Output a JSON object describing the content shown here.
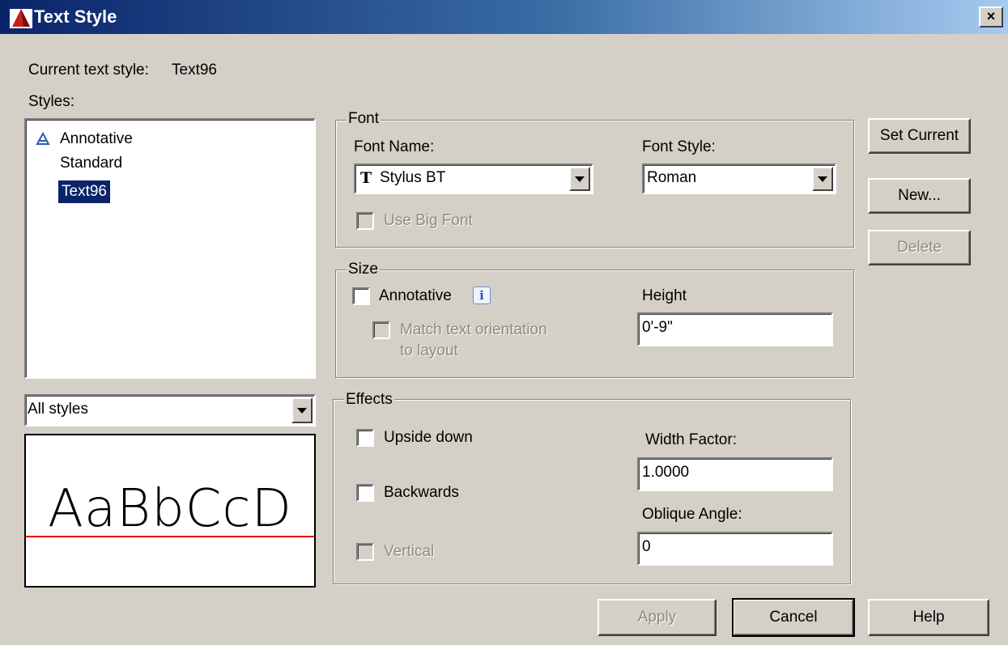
{
  "window": {
    "title": "Text Style",
    "close_glyph": "×"
  },
  "current_style": {
    "label": "Current text style:",
    "value": "Text96"
  },
  "styles": {
    "label": "Styles:",
    "items": [
      {
        "label": "Annotative",
        "icon": "annotative-icon",
        "selected": false
      },
      {
        "label": "Standard",
        "selected": false
      },
      {
        "label": "Text96",
        "selected": true
      }
    ],
    "filter_value": "All styles"
  },
  "preview": {
    "sample_text": "AaBbCcD",
    "baseline_color": "#e00000"
  },
  "font": {
    "group_label": "Font",
    "name_label": "Font Name:",
    "name_value": "Stylus BT",
    "name_icon": "truetype-font-icon",
    "style_label": "Font Style:",
    "style_value": "Roman",
    "big_font_label": "Use Big Font",
    "big_font_checked": false
  },
  "size": {
    "group_label": "Size",
    "annotative_label": "Annotative",
    "annotative_checked": false,
    "info_glyph": "i",
    "match_label_line1": "Match text orientation",
    "match_label_line2": "to layout",
    "height_label": "Height",
    "height_value": "0'-9\""
  },
  "effects": {
    "group_label": "Effects",
    "upside_down_label": "Upside down",
    "backwards_label": "Backwards",
    "vertical_label": "Vertical",
    "width_factor_label": "Width Factor:",
    "width_factor_value": "1.0000",
    "oblique_label": "Oblique Angle:",
    "oblique_value": "0"
  },
  "buttons": {
    "set_current": "Set Current",
    "new": "New...",
    "delete": "Delete",
    "apply": "Apply",
    "cancel": "Cancel",
    "help": "Help"
  },
  "colors": {
    "titlebar_start": "#0a246a",
    "selection": "#0a246a",
    "face": "#d4d0c8"
  }
}
